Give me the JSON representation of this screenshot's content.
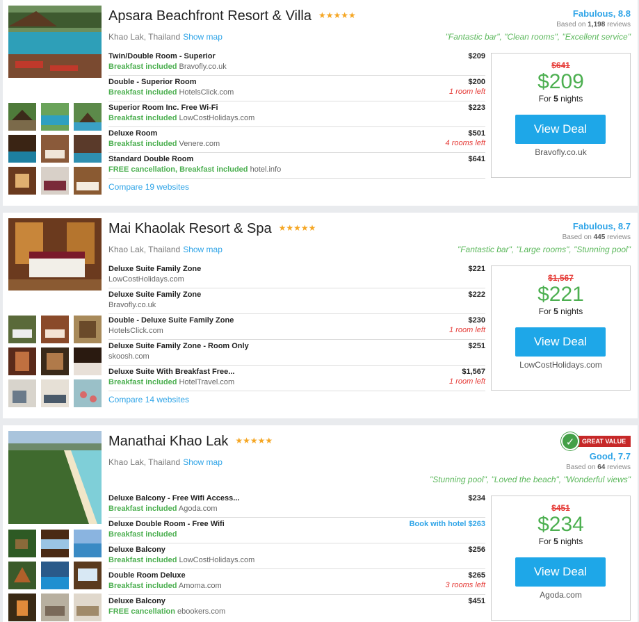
{
  "hotels": [
    {
      "name": "Apsara Beachfront Resort & Villa",
      "stars": "★★★★★",
      "location": "Khao Lak, Thailand",
      "show_map": "Show map",
      "rating": "Fabulous, 8.8",
      "reviews_prefix": "Based on",
      "reviews_count": "1,198",
      "reviews_suffix": "reviews",
      "quotes": "\"Fantastic bar\", \"Clean rooms\", \"Excellent service\"",
      "offers": [
        {
          "room": "Twin/Double Room - Superior",
          "included": "Breakfast included",
          "site": "Bravofly.co.uk",
          "price": "$209",
          "left": ""
        },
        {
          "room": "Double - Superior Room",
          "included": "Breakfast included",
          "site": "HotelsClick.com",
          "price": "$200",
          "left": "1 room left"
        },
        {
          "room": "Superior Room Inc. Free Wi-Fi",
          "included": "Breakfast included",
          "site": "LowCostHolidays.com",
          "price": "$223",
          "left": ""
        },
        {
          "room": "Deluxe Room",
          "included": "Breakfast included",
          "site": "Venere.com",
          "price": "$501",
          "left": "4 rooms left"
        },
        {
          "room": "Standard Double Room",
          "included": "FREE cancellation, Breakfast included",
          "site": "hotel.info",
          "price": "$641",
          "left": ""
        }
      ],
      "compare": "Compare 19 websites",
      "deal": {
        "old_price": "$641",
        "price": "$209",
        "nights_prefix": "For",
        "nights_count": "5",
        "nights_suffix": "nights",
        "button": "View Deal",
        "site": "Bravofly.co.uk"
      }
    },
    {
      "name": "Mai Khaolak Resort & Spa",
      "stars": "★★★★★",
      "location": "Khao Lak, Thailand",
      "show_map": "Show map",
      "rating": "Fabulous, 8.7",
      "reviews_prefix": "Based on",
      "reviews_count": "445",
      "reviews_suffix": "reviews",
      "quotes": "\"Fantastic bar\", \"Large rooms\", \"Stunning pool\"",
      "offers": [
        {
          "room": "Deluxe Suite Family Zone",
          "included": "",
          "site": "LowCostHolidays.com",
          "price": "$221",
          "left": ""
        },
        {
          "room": "Deluxe Suite Family Zone",
          "included": "",
          "site": "Bravofly.co.uk",
          "price": "$222",
          "left": ""
        },
        {
          "room": "Double - Deluxe Suite Family Zone",
          "included": "",
          "site": "HotelsClick.com",
          "price": "$230",
          "left": "1 room left"
        },
        {
          "room": "Deluxe Suite Family Zone - Room Only",
          "included": "",
          "site": "skoosh.com",
          "price": "$251",
          "left": ""
        },
        {
          "room": "Deluxe Suite With Breakfast Free...",
          "included": "Breakfast included",
          "site": "HotelTravel.com",
          "price": "$1,567",
          "left": "1 room left"
        }
      ],
      "compare": "Compare 14 websites",
      "deal": {
        "old_price": "$1,567",
        "price": "$221",
        "nights_prefix": "For",
        "nights_count": "5",
        "nights_suffix": "nights",
        "button": "View Deal",
        "site": "LowCostHolidays.com"
      }
    },
    {
      "name": "Manathai Khao Lak",
      "stars": "★★★★★",
      "location": "Khao Lak, Thailand",
      "show_map": "Show map",
      "badge": "GREAT VALUE",
      "rating": "Good, 7.7",
      "reviews_prefix": "Based on",
      "reviews_count": "64",
      "reviews_suffix": "reviews",
      "quotes": "\"Stunning pool\", \"Loved the beach\", \"Wonderful views\"",
      "offers": [
        {
          "room": "Deluxe Balcony - Free Wifi Access...",
          "included": "Breakfast included",
          "site": "Agoda.com",
          "price": "$234",
          "left": ""
        },
        {
          "room": "Deluxe Double Room - Free Wifi",
          "included": "Breakfast included",
          "site": "",
          "price": "Book with hotel $263",
          "left": ""
        },
        {
          "room": "Deluxe Balcony",
          "included": "Breakfast included",
          "site": "LowCostHolidays.com",
          "price": "$256",
          "left": ""
        },
        {
          "room": "Double Room Deluxe",
          "included": "Breakfast included",
          "site": "Amoma.com",
          "price": "$265",
          "left": "3 rooms left"
        },
        {
          "room": "Deluxe Balcony",
          "included": "FREE cancellation",
          "site": "ebookers.com",
          "price": "$451",
          "left": ""
        }
      ],
      "deal": {
        "old_price": "$451",
        "price": "$234",
        "nights_prefix": "For",
        "nights_count": "5",
        "nights_suffix": "nights",
        "button": "View Deal",
        "site": "Agoda.com"
      }
    }
  ]
}
